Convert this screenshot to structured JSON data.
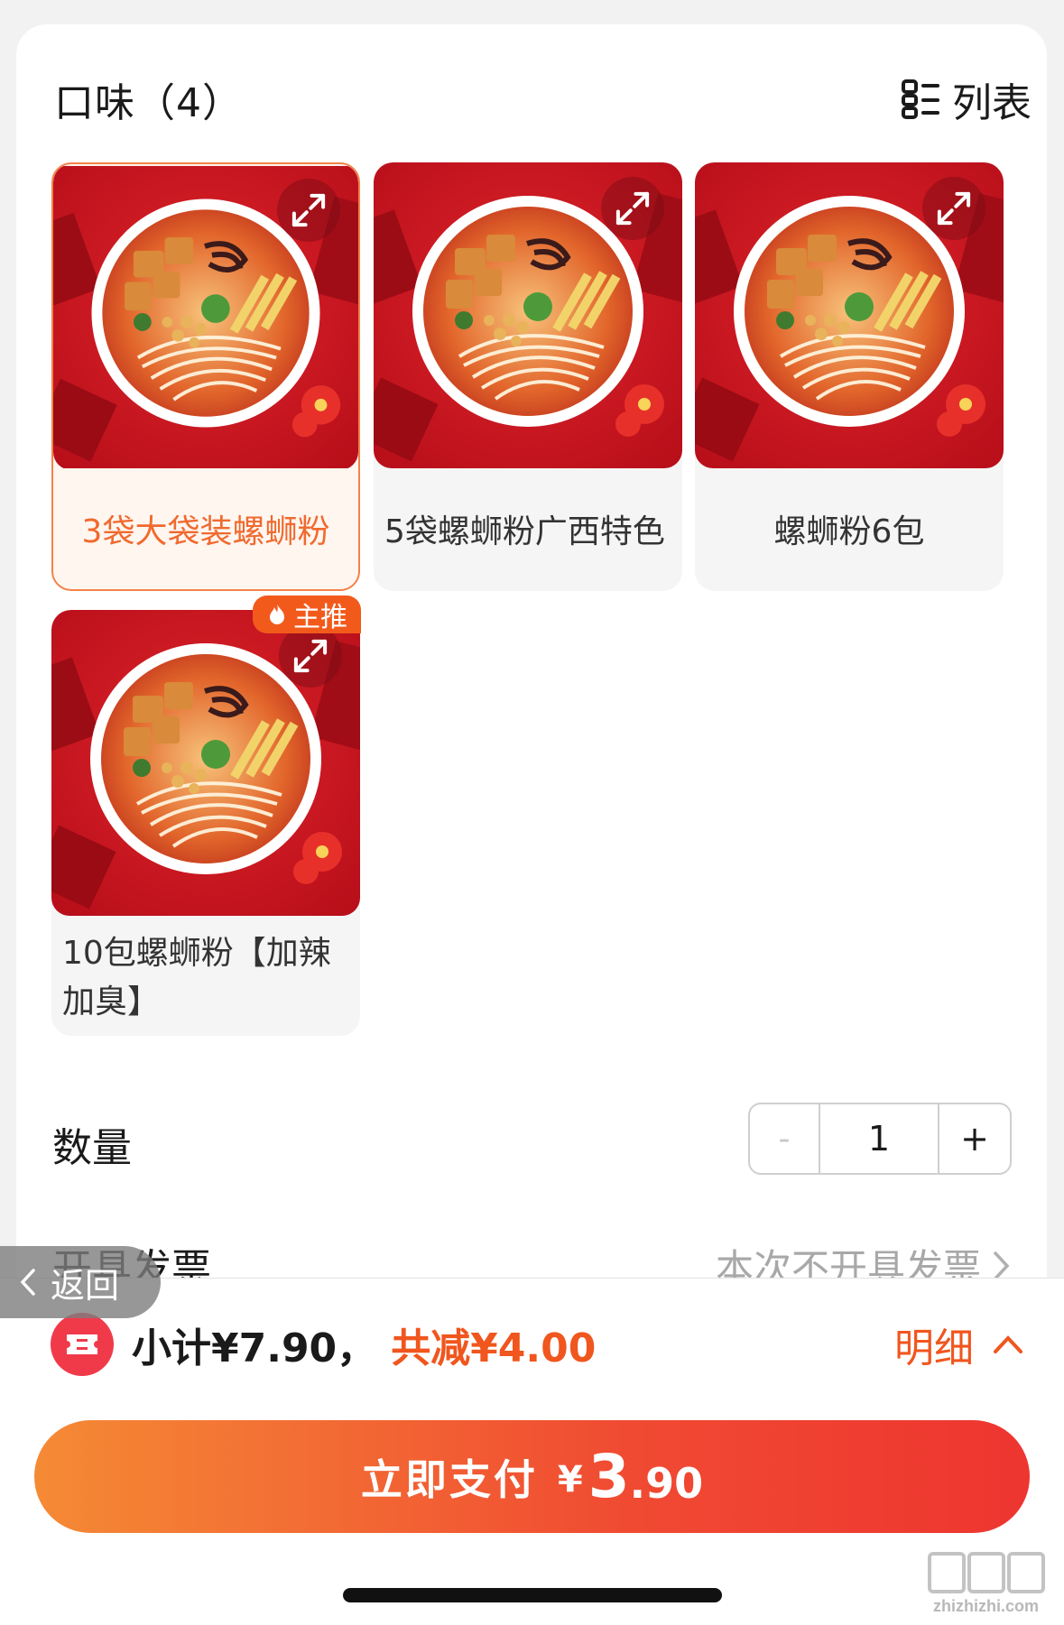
{
  "flavor_section": {
    "title": "口味（4）",
    "list_toggle_label": "列表",
    "options": [
      {
        "label": "3袋大袋装螺蛳粉",
        "selected": true
      },
      {
        "label": "5袋螺蛳粉广西特色",
        "selected": false
      },
      {
        "label": "螺蛳粉6包",
        "selected": false
      },
      {
        "label": "10包螺蛳粉【加辣加臭】",
        "selected": false,
        "badge": "主推"
      }
    ]
  },
  "quantity": {
    "label": "数量",
    "minus": "-",
    "value": "1",
    "plus": "+"
  },
  "invoice": {
    "label": "开具发票",
    "value": "本次不开具发票"
  },
  "back_button": {
    "label": "返回"
  },
  "summary": {
    "subtotal": "小计¥7.90，",
    "discount": "共减¥4.00",
    "detail_label": "明细"
  },
  "pay_button": {
    "label": "立即支付",
    "currency": "¥",
    "amount_int": "3",
    "amount_dec": ".90"
  },
  "watermark": {
    "site": "zhizhizhi.com"
  },
  "colors": {
    "accent": "#f0561e",
    "selected_border": "#f3824a",
    "coupon": "#f03a4a",
    "pay_gradient_start": "#f58a35",
    "pay_gradient_end": "#ee3530"
  }
}
